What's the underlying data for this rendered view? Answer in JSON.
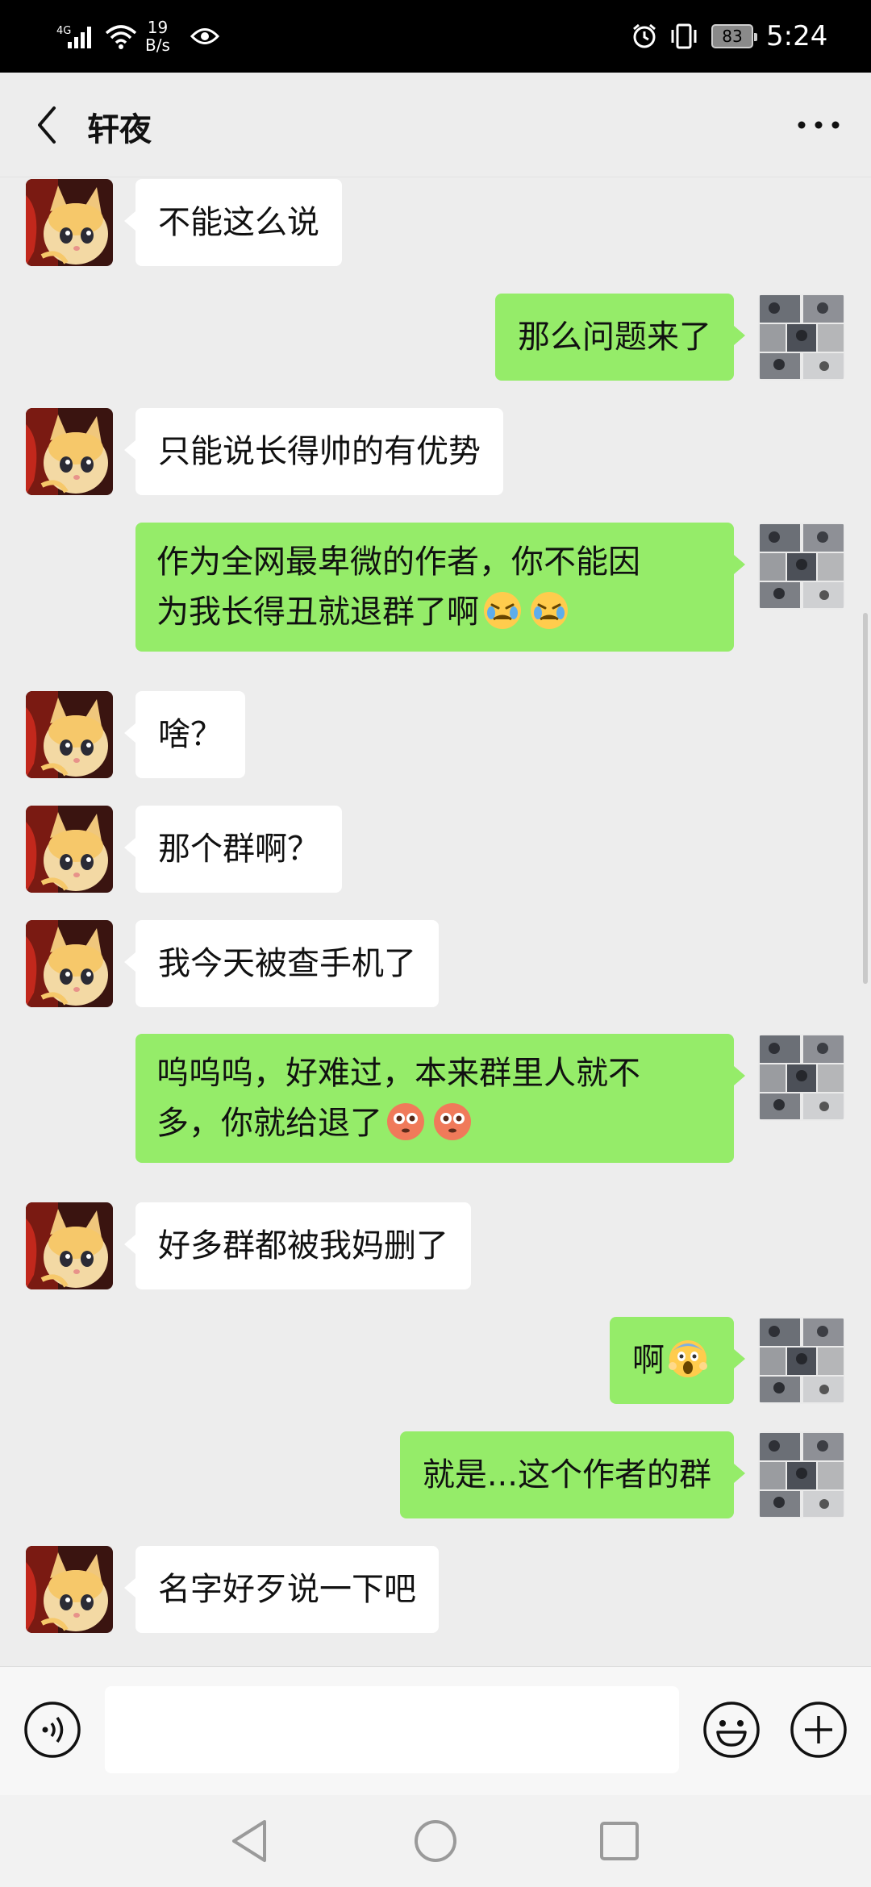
{
  "status_bar": {
    "network": "4G",
    "speed_value": "19",
    "speed_unit": "B/s",
    "battery": "83",
    "time": "5:24"
  },
  "header": {
    "title": "轩夜"
  },
  "messages": [
    {
      "side": "left",
      "text": "不能这么说"
    },
    {
      "side": "right",
      "text": "那么问题来了"
    },
    {
      "side": "left",
      "text": "只能说长得帅的有优势"
    },
    {
      "side": "right",
      "line1": "作为全网最卑微的作者，你不能因",
      "line2": "为我长得丑就退群了啊",
      "emoji": "crying-face-emoji"
    },
    {
      "side": "left",
      "text": "啥？"
    },
    {
      "side": "left",
      "text": "那个群啊？"
    },
    {
      "side": "left",
      "text": "我今天被查手机了"
    },
    {
      "side": "right",
      "line1": "呜呜呜，好难过，本来群里人就不",
      "line2": "多，你就给退了",
      "emoji": "flushed-face-emoji"
    },
    {
      "side": "left",
      "text": "好多群都被我妈删了"
    },
    {
      "side": "right",
      "text": "啊",
      "emoji": "screaming-face-emoji"
    },
    {
      "side": "right",
      "text": "就是...这个作者的群"
    },
    {
      "side": "left",
      "text": "名字好歹说一下吧"
    }
  ],
  "input": {
    "value": "",
    "placeholder": ""
  },
  "colors": {
    "sent_bubble": "#95ec69",
    "received_bubble": "#ffffff",
    "background": "#ededed"
  },
  "icons": [
    "back-arrow-icon",
    "more-dots-icon",
    "voice-icon",
    "emoji-icon",
    "plus-icon",
    "nav-back-icon",
    "nav-home-icon",
    "nav-recent-icon"
  ]
}
